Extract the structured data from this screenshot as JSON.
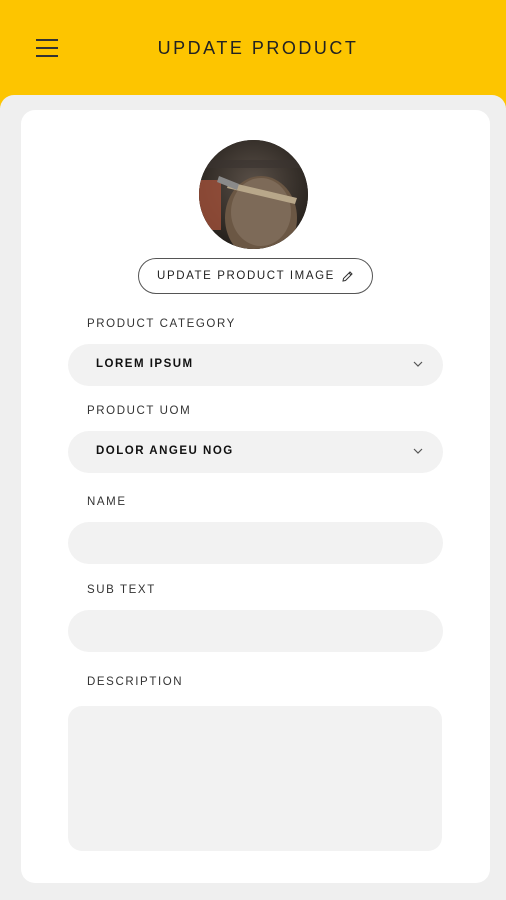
{
  "header": {
    "title": "UPDATE PRODUCT",
    "background": "#fdc500"
  },
  "image_button": {
    "label": "UPDATE PRODUCT IMAGE"
  },
  "fields": {
    "category": {
      "label": "PRODUCT CATEGORY",
      "value": "LOREM IPSUM"
    },
    "uom": {
      "label": "PRODUCT UOM",
      "value": "DOLOR ANGEU NOG"
    },
    "name": {
      "label": "NAME",
      "value": ""
    },
    "sub_text": {
      "label": "SUB TEXT",
      "value": ""
    },
    "description": {
      "label": "DESCRIPTION",
      "value": ""
    }
  },
  "icons": {
    "menu": "hamburger-menu-icon",
    "edit": "pencil-icon",
    "dropdown": "chevron-down-icon"
  }
}
